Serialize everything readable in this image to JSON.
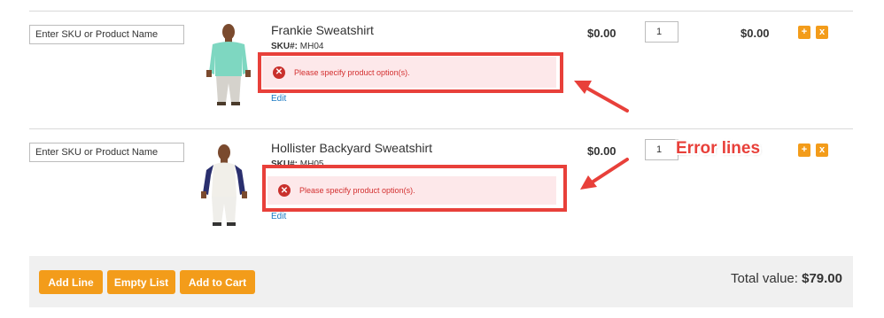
{
  "rows": [
    {
      "sku_placeholder": "Enter SKU or Product Name",
      "product_name": "Frankie Sweatshirt",
      "sku_label": "SKU#:",
      "sku_value": "MH04",
      "error_message": "Please specify product option(s).",
      "edit_label": "Edit",
      "price": "$0.00",
      "qty": "1",
      "subtotal": "$0.00",
      "add_label": "+",
      "remove_label": "x"
    },
    {
      "sku_placeholder": "Enter SKU or Product Name",
      "product_name": "Hollister Backyard Sweatshirt",
      "sku_label": "SKU#:",
      "sku_value": "MH05",
      "error_message": "Please specify product option(s).",
      "edit_label": "Edit",
      "price": "$0.00",
      "qty": "1",
      "add_label": "+",
      "remove_label": "x"
    }
  ],
  "annotation": {
    "callout": "Error lines",
    "color": "#e8403a"
  },
  "footer": {
    "add_line": "Add Line",
    "empty_list": "Empty List",
    "add_to_cart": "Add to Cart",
    "total_label": "Total value:",
    "total_value": "$79.00"
  },
  "colors": {
    "accent": "#f39c1a",
    "error_bg": "#fde8ea",
    "error_text": "#d32f2f",
    "link": "#1979c3"
  }
}
